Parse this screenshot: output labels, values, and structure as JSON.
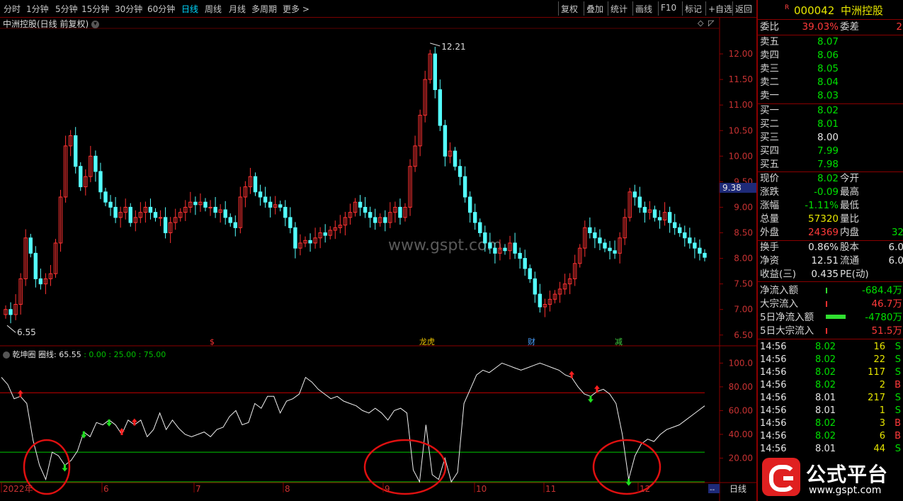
{
  "toolbar": {
    "periods": [
      "分时",
      "1分钟",
      "5分钟",
      "15分钟",
      "30分钟",
      "60分钟",
      "日线",
      "周线",
      "月线",
      "多周期",
      "更多 >"
    ],
    "active_period": "日线",
    "right_buttons": [
      "复权",
      "叠加",
      "统计",
      "画线",
      "F10",
      "标记",
      "+自选",
      "返回"
    ]
  },
  "chart_title": "中洲控股(日线 前复权)",
  "price_axis": [
    "12.00",
    "11.50",
    "11.00",
    "10.50",
    "10.00",
    "9.50",
    "9.00",
    "8.50",
    "8.00",
    "7.50",
    "7.00",
    "6.50"
  ],
  "price_high_label": "12.21",
  "price_low_label": "6.55",
  "current_axis_value": "9.38",
  "watermark": "www.gspt.com",
  "event_markers": [
    "$",
    "龙虎",
    "财",
    "减"
  ],
  "indicator": {
    "name": "乾坤圈",
    "line_label": "圈线: 65.55",
    "levels_text": ": 0.00 : 25.00 : 75.00",
    "axis": [
      "100.0",
      "80.00",
      "60.00",
      "40.00",
      "20.00"
    ]
  },
  "date_axis": [
    "2022年",
    "6",
    "7",
    "8",
    "9",
    "10",
    "11",
    "12"
  ],
  "bottom_period_tab": "日线",
  "bottom_arrow": "--",
  "side": {
    "badge": "R",
    "code": "000042",
    "name": "中洲控股",
    "weibi_label": "委比",
    "weibi_value": "39.03%",
    "weicha_label": "委差",
    "weicha_value": "2",
    "asks": [
      {
        "label": "卖五",
        "price": "8.07"
      },
      {
        "label": "卖四",
        "price": "8.06"
      },
      {
        "label": "卖三",
        "price": "8.05"
      },
      {
        "label": "卖二",
        "price": "8.04"
      },
      {
        "label": "卖一",
        "price": "8.03"
      }
    ],
    "bids": [
      {
        "label": "买一",
        "price": "8.02"
      },
      {
        "label": "买二",
        "price": "8.01"
      },
      {
        "label": "买三",
        "price": "8.00"
      },
      {
        "label": "买四",
        "price": "7.99"
      },
      {
        "label": "买五",
        "price": "7.98"
      }
    ],
    "quote": [
      {
        "l": "现价",
        "v": "8.02",
        "l2": "今开",
        "c": "green"
      },
      {
        "l": "涨跌",
        "v": "-0.09",
        "l2": "最高",
        "c": "green"
      },
      {
        "l": "涨幅",
        "v": "-1.11%",
        "l2": "最低",
        "c": "green"
      },
      {
        "l": "总量",
        "v": "57320",
        "l2": "量比",
        "c": "yellow"
      },
      {
        "l": "外盘",
        "v": "24369",
        "l2": "内盘",
        "c": "red",
        "v2": "32"
      }
    ],
    "stats": [
      {
        "l": "换手",
        "v": "0.86%",
        "l2": "股本",
        "v2": "6.0"
      },
      {
        "l": "净资",
        "v": "12.51",
        "l2": "流通",
        "v2": "6.0"
      },
      {
        "l": "收益(三)",
        "v": "0.435",
        "l2": "PE(动)",
        "v2": ""
      }
    ],
    "flows": [
      {
        "l": "净流入额",
        "v": "-684.4万",
        "c": "green",
        "bar": "tiny-green"
      },
      {
        "l": "大宗流入",
        "v": "46.7万",
        "c": "red",
        "bar": "tiny-red"
      },
      {
        "l": "5日净流入额",
        "v": "-4780万",
        "c": "green",
        "bar": "big-green"
      },
      {
        "l": "5日大宗流入",
        "v": "51.5万",
        "c": "red",
        "bar": "tiny-red"
      }
    ],
    "ticks": [
      {
        "t": "14:56",
        "p": "8.02",
        "v": "16",
        "s": "S"
      },
      {
        "t": "14:56",
        "p": "8.02",
        "v": "22",
        "s": "S"
      },
      {
        "t": "14:56",
        "p": "8.02",
        "v": "117",
        "s": "S"
      },
      {
        "t": "14:56",
        "p": "8.02",
        "v": "2",
        "s": "B"
      },
      {
        "t": "14:56",
        "p": "8.01",
        "v": "217",
        "s": "S"
      },
      {
        "t": "14:56",
        "p": "8.01",
        "v": "1",
        "s": "S"
      },
      {
        "t": "14:56",
        "p": "8.02",
        "v": "3",
        "s": "B"
      },
      {
        "t": "14:56",
        "p": "8.02",
        "v": "6",
        "s": "B"
      },
      {
        "t": "14:56",
        "p": "8.01",
        "v": "44",
        "s": "S"
      }
    ],
    "logo_text": "公式平台",
    "logo_url": "www.gspt.com"
  },
  "chart_data": {
    "type": "candlestick",
    "price_ylim": [
      6.4,
      12.5
    ],
    "close_series": [
      7.0,
      6.9,
      7.1,
      7.6,
      8.4,
      8.1,
      7.6,
      7.5,
      7.6,
      7.7,
      8.3,
      9.2,
      10.2,
      10.4,
      9.8,
      9.4,
      9.6,
      10.0,
      9.7,
      9.3,
      9.1,
      9.0,
      8.8,
      8.9,
      9.0,
      8.7,
      8.8,
      8.9,
      9.0,
      8.9,
      8.8,
      8.8,
      8.5,
      8.7,
      8.8,
      8.9,
      9.0,
      9.1,
      9.05,
      9.1,
      9.0,
      9.0,
      8.9,
      8.95,
      8.8,
      8.7,
      8.6,
      9.2,
      9.4,
      9.6,
      9.3,
      9.2,
      9.1,
      9.0,
      9.05,
      9.0,
      8.8,
      8.6,
      8.2,
      8.3,
      8.35,
      8.3,
      8.4,
      8.5,
      8.45,
      8.55,
      8.6,
      8.65,
      8.8,
      8.9,
      9.1,
      9.0,
      8.9,
      8.8,
      8.7,
      8.8,
      8.7,
      8.9,
      9.0,
      8.8,
      9.0,
      9.8,
      10.2,
      10.8,
      11.5,
      12.0,
      11.3,
      10.6,
      10.0,
      10.1,
      9.8,
      9.6,
      9.2,
      8.9,
      8.7,
      8.5,
      8.3,
      8.2,
      8.1,
      8.2,
      8.15,
      8.3,
      8.1,
      8.0,
      7.8,
      7.6,
      7.3,
      7.05,
      7.1,
      7.2,
      7.3,
      7.4,
      7.5,
      7.6,
      7.9,
      8.2,
      8.6,
      8.5,
      8.4,
      8.3,
      8.2,
      8.15,
      8.1,
      8.4,
      8.8,
      9.3,
      9.2,
      9.0,
      8.9,
      8.95,
      8.8,
      8.75,
      8.9,
      8.7,
      8.6,
      8.5,
      8.4,
      8.3,
      8.2,
      8.1,
      8.02
    ],
    "indicator_ylim": [
      0,
      105
    ],
    "indicator_levels": [
      0,
      25,
      75
    ],
    "indicator_series": [
      88,
      82,
      70,
      72,
      66,
      35,
      14,
      2,
      25,
      22,
      14,
      18,
      26,
      42,
      38,
      50,
      48,
      52,
      48,
      40,
      52,
      48,
      52,
      38,
      44,
      58,
      44,
      52,
      45,
      40,
      38,
      40,
      42,
      38,
      44,
      46,
      55,
      60,
      48,
      50,
      66,
      62,
      72,
      72,
      58,
      68,
      70,
      74,
      88,
      84,
      78,
      74,
      70,
      72,
      68,
      66,
      64,
      60,
      58,
      62,
      58,
      52,
      60,
      62,
      58,
      10,
      0,
      48,
      6,
      2,
      20,
      0,
      8,
      66,
      78,
      90,
      94,
      92,
      96,
      100,
      98,
      96,
      94,
      96,
      98,
      100,
      98,
      96,
      94,
      90,
      88,
      80,
      74,
      72,
      76,
      78,
      74,
      66,
      40,
      2,
      22,
      32,
      36,
      34,
      40,
      44,
      46,
      48,
      52,
      56,
      60,
      64
    ],
    "buy_signal_positions": [
      3,
      19,
      21,
      90,
      94,
      138,
      162
    ],
    "sell_signal_positions": [
      10,
      13,
      17,
      93,
      99,
      142,
      145,
      160
    ]
  }
}
